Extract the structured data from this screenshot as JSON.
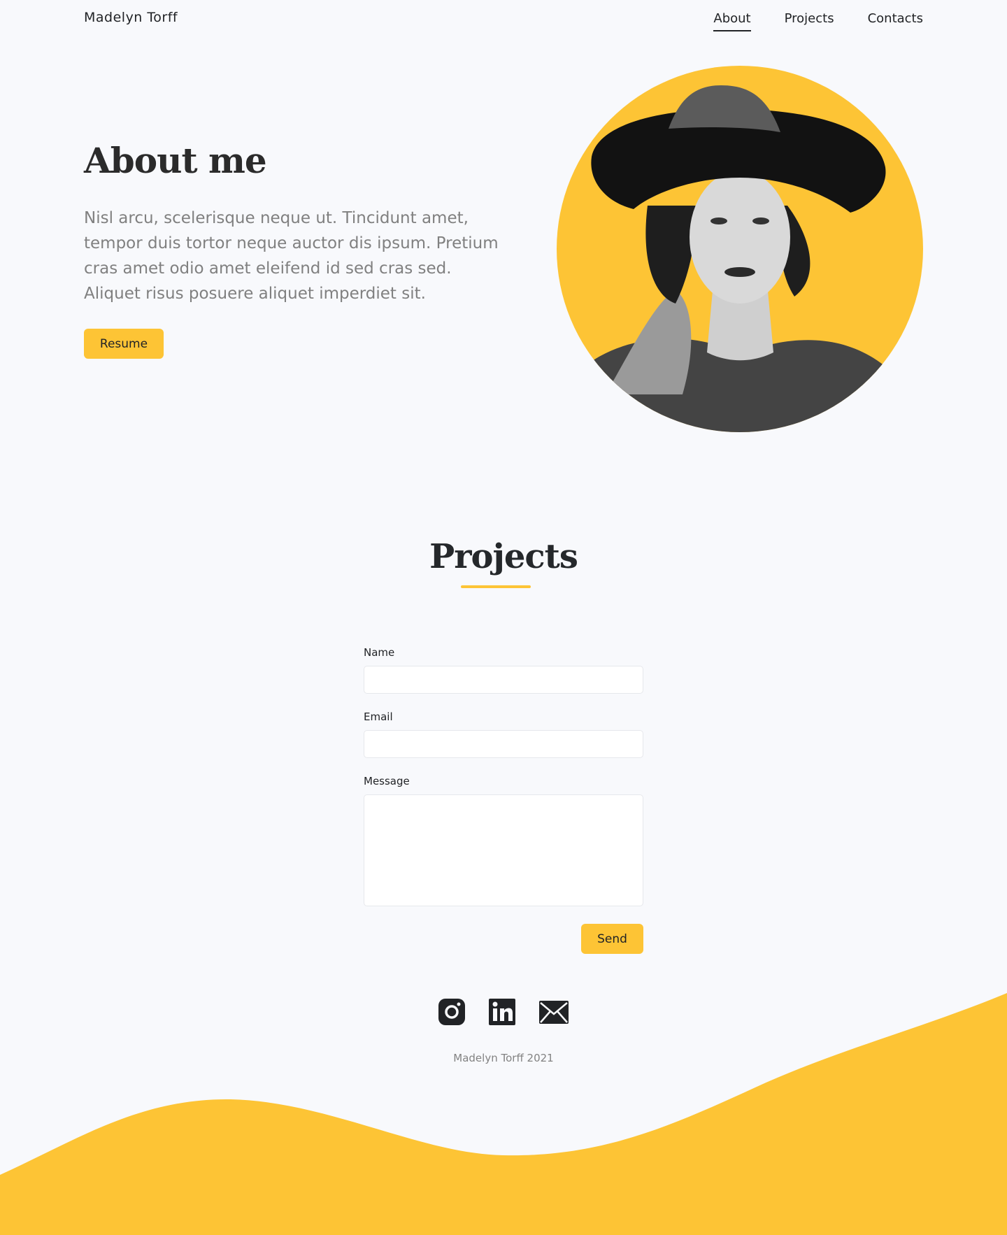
{
  "header": {
    "brand": "Madelyn Torff",
    "nav": [
      {
        "label": "About",
        "active": true
      },
      {
        "label": "Projects",
        "active": false
      },
      {
        "label": "Contacts",
        "active": false
      }
    ]
  },
  "hero": {
    "title": "About me",
    "text": "Nisl arcu, scelerisque neque ut. Tincidunt amet, tempor duis tortor neque auctor dis ipsum. Pretium cras amet odio amet eleifend id sed cras sed. Aliquet risus posuere aliquet imperdiet sit.",
    "resume_label": "Resume",
    "photo": "portrait-photo"
  },
  "projects": {
    "title": "Projects"
  },
  "form": {
    "name_label": "Name",
    "name_value": "",
    "email_label": "Email",
    "email_value": "",
    "message_label": "Message",
    "message_value": "",
    "send_label": "Send"
  },
  "footer": {
    "socials": [
      "instagram-icon",
      "linkedin-icon",
      "mail-icon"
    ],
    "copyright": "Madelyn Torff 2021"
  },
  "colors": {
    "accent": "#fdc435",
    "background": "#f8f9fc",
    "text": "#212326",
    "muted": "#808080"
  }
}
